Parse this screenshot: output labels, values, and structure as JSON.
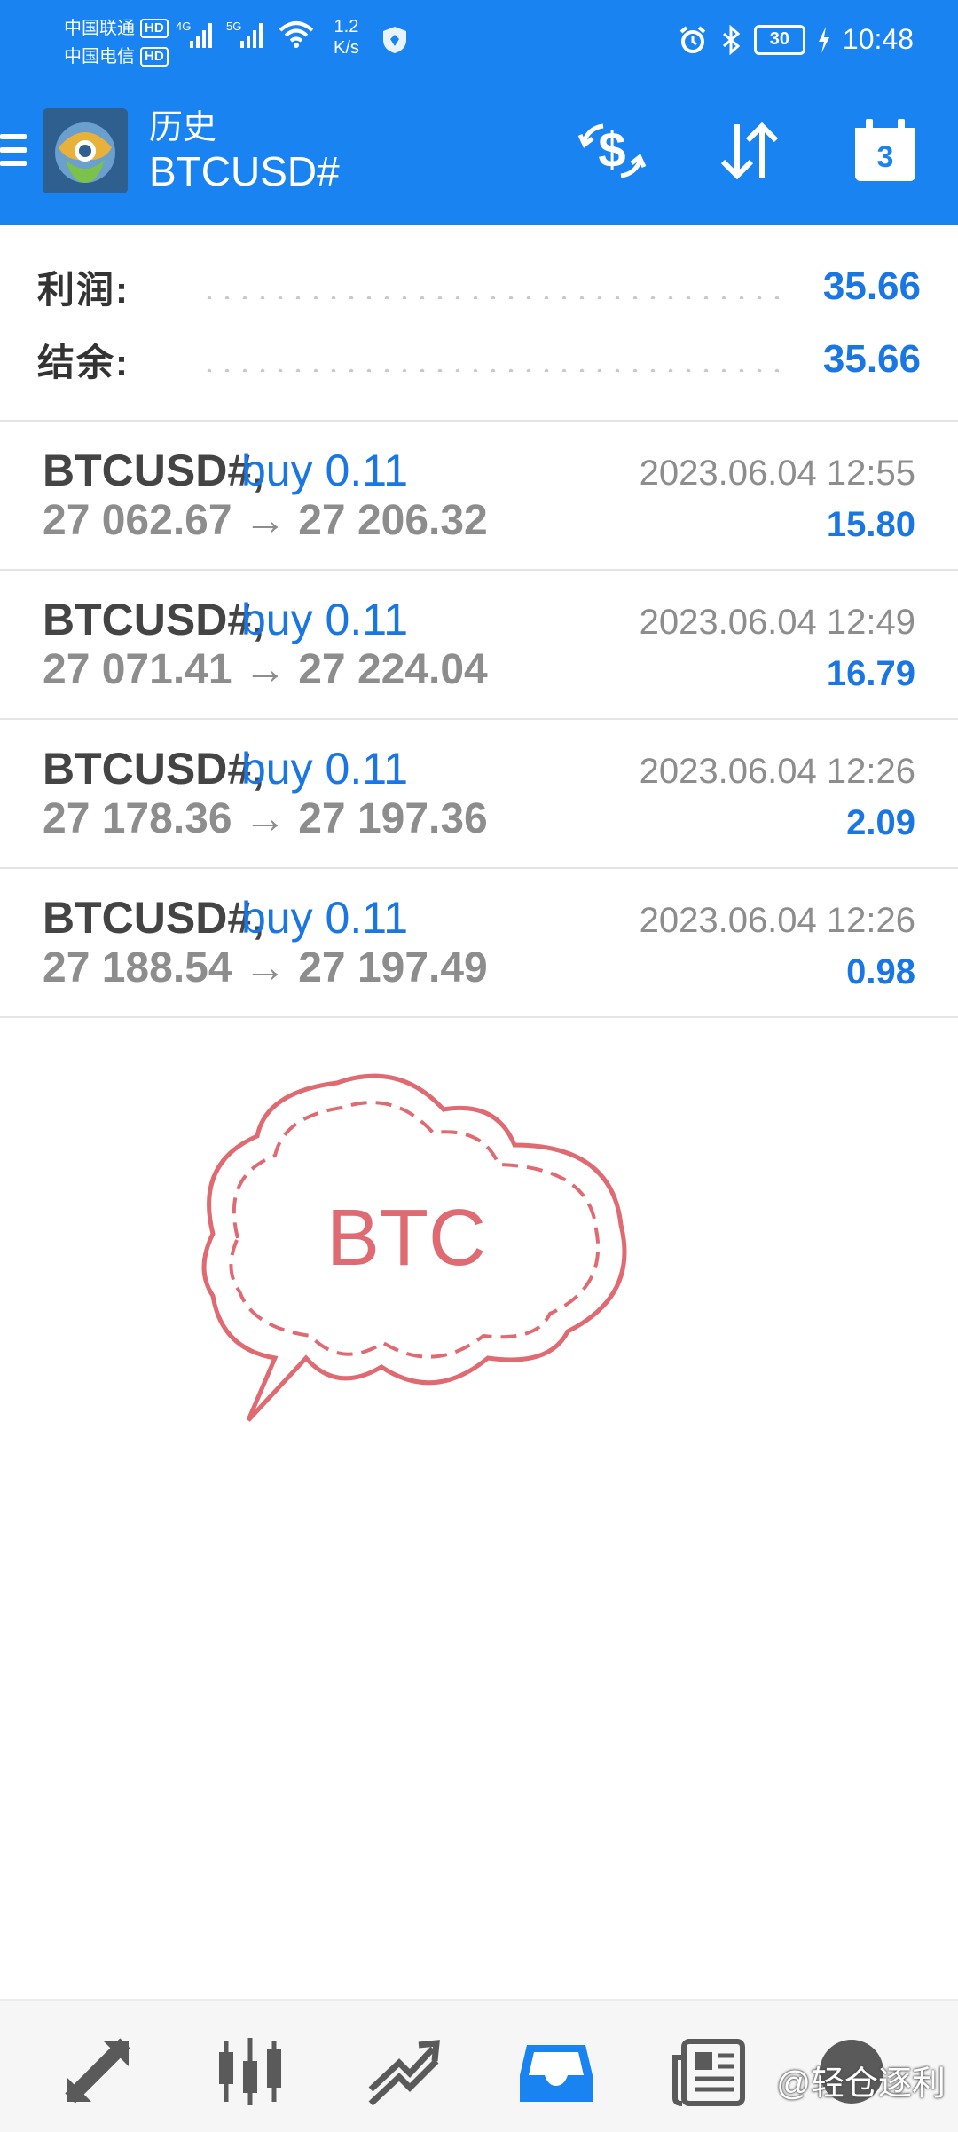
{
  "status_bar": {
    "carrier_1": "中国联通",
    "carrier_2": "中国电信",
    "hd_label": "HD",
    "net_gen_1": "4G",
    "net_gen_2": "5G",
    "net_speed_value": "1.2",
    "net_speed_unit": "K/s",
    "battery": "30",
    "time": "10:48"
  },
  "toolbar": {
    "subtitle": "历史",
    "title": "BTCUSD#",
    "calendar_day": "3",
    "accent_color": "#1a83f2"
  },
  "summary": {
    "profit_label": "利润:",
    "profit_value": "35.66",
    "balance_label": "结余:",
    "balance_value": "35.66"
  },
  "deals": [
    {
      "symbol": "BTCUSD#",
      "separator": ",",
      "type": "buy 0.11",
      "prices": "27 062.67 → 27 206.32",
      "time": "2023.06.04 12:55",
      "profit": "15.80"
    },
    {
      "symbol": "BTCUSD#",
      "separator": ",",
      "type": "buy 0.11",
      "prices": "27 071.41 → 27 224.04",
      "time": "2023.06.04 12:49",
      "profit": "16.79"
    },
    {
      "symbol": "BTCUSD#",
      "separator": ",",
      "type": "buy 0.11",
      "prices": "27 178.36 → 27 197.36",
      "time": "2023.06.04 12:26",
      "profit": "2.09"
    },
    {
      "symbol": "BTCUSD#",
      "separator": ",",
      "type": "buy 0.11",
      "prices": "27 188.54 → 27 197.49",
      "time": "2023.06.04 12:26",
      "profit": "0.98"
    }
  ],
  "stamp": {
    "text": "BTC",
    "color": "#e06a72"
  },
  "bottom_nav": {
    "items": [
      "quotes-icon",
      "chart-icon",
      "trade-icon",
      "history-icon",
      "news-icon",
      "chat-icon"
    ],
    "active": "history-icon",
    "watermark": "@轻仓逐利"
  }
}
